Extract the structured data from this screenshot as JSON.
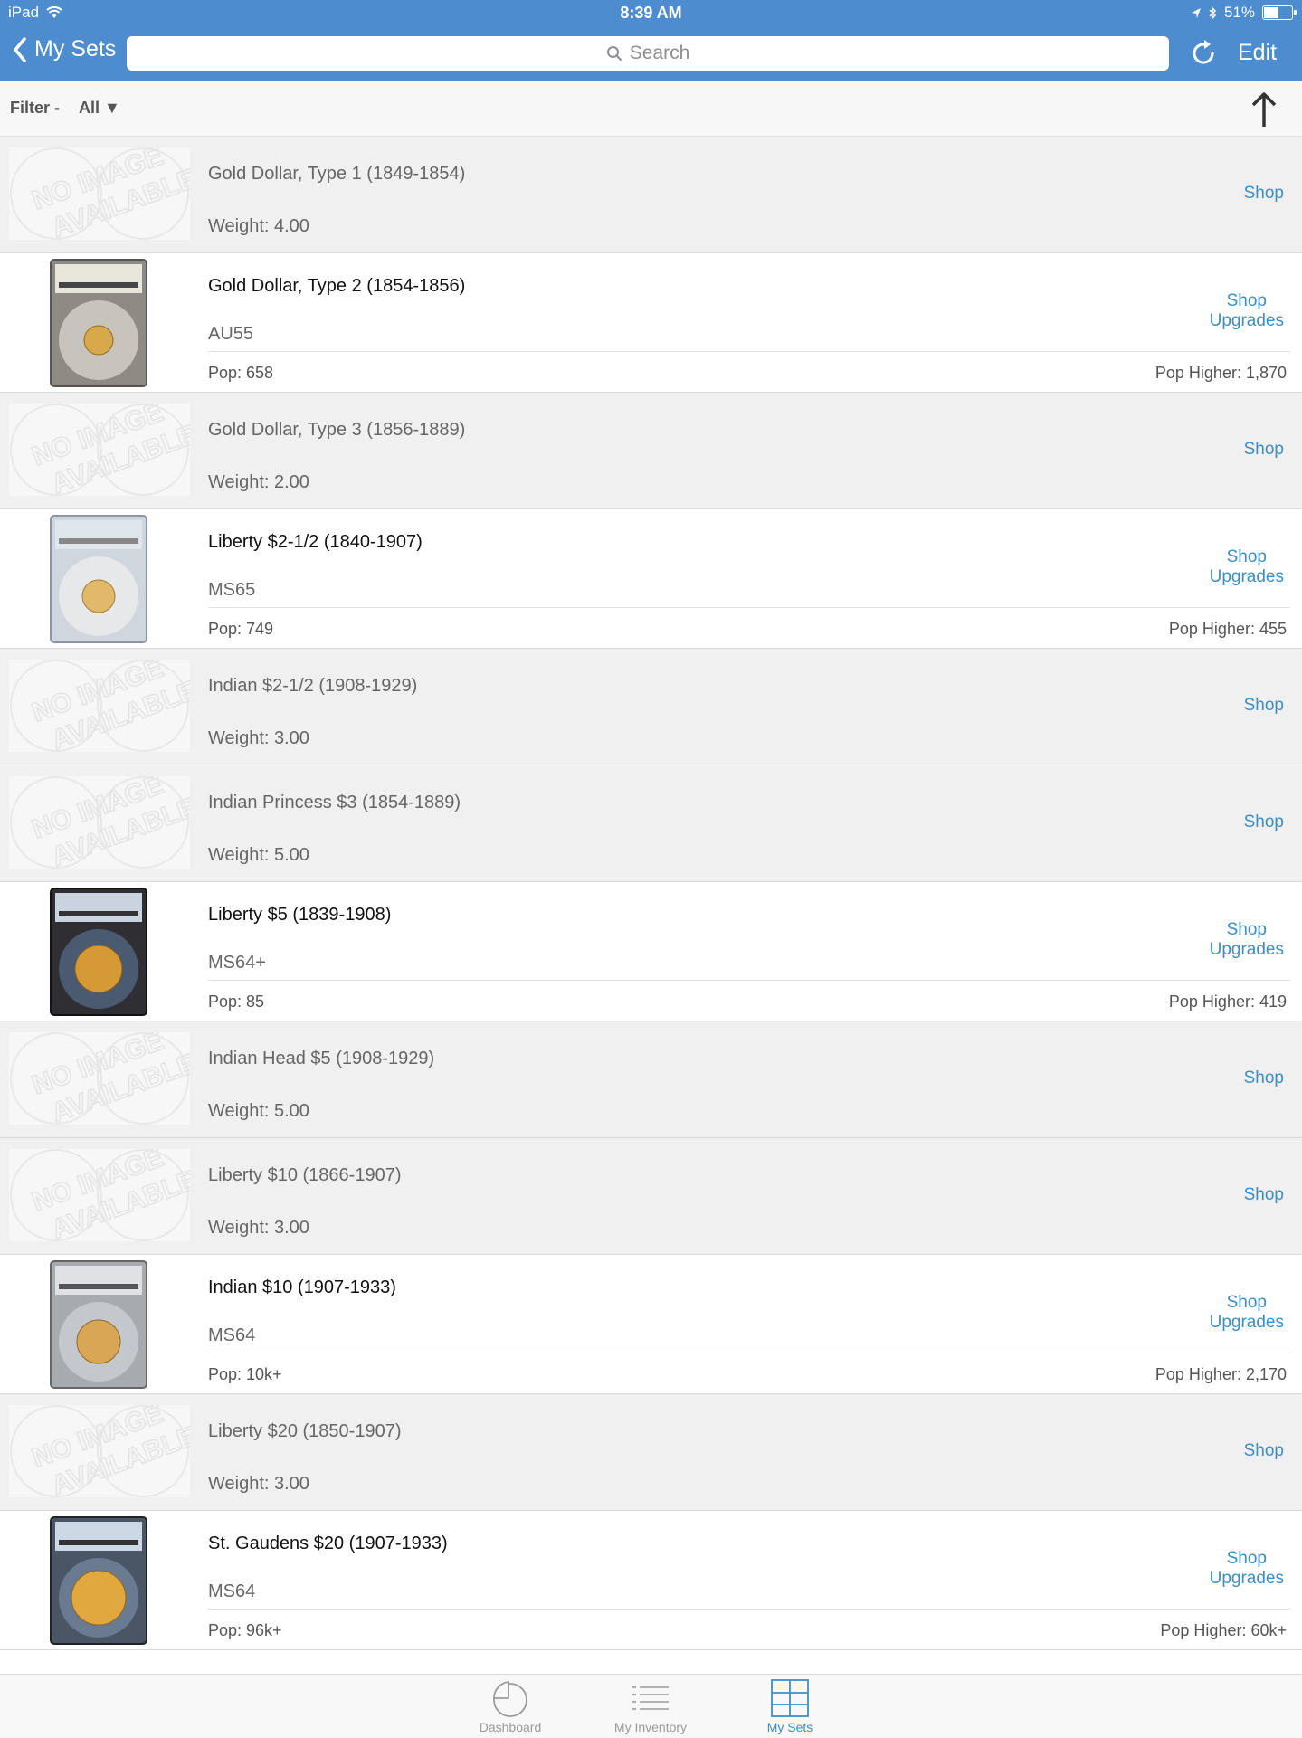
{
  "status_bar": {
    "device": "iPad",
    "time": "8:39 AM",
    "battery": "51%"
  },
  "nav": {
    "back_label": "My Sets",
    "search_placeholder": "Search",
    "edit_label": "Edit"
  },
  "filter": {
    "label": "Filter -",
    "value": "All ▼"
  },
  "rows": [
    {
      "title": "Gold Dollar, Type 1 (1849-1854)",
      "sub": "Weight: 4.00",
      "shop": "Shop"
    },
    {
      "title": "Gold Dollar, Type 2 (1854-1856)",
      "sub": "AU55",
      "shop_line1": "Shop",
      "shop_line2": "Upgrades",
      "pop": "Pop: 658",
      "pop_higher": "Pop Higher: 1,870"
    },
    {
      "title": "Gold Dollar, Type 3 (1856-1889)",
      "sub": "Weight: 2.00",
      "shop": "Shop"
    },
    {
      "title": "Liberty $2-1/2 (1840-1907)",
      "sub": "MS65",
      "shop_line1": "Shop",
      "shop_line2": "Upgrades",
      "pop": "Pop: 749",
      "pop_higher": "Pop Higher: 455"
    },
    {
      "title": "Indian $2-1/2 (1908-1929)",
      "sub": "Weight: 3.00",
      "shop": "Shop"
    },
    {
      "title": "Indian Princess $3 (1854-1889)",
      "sub": "Weight: 5.00",
      "shop": "Shop"
    },
    {
      "title": "Liberty $5 (1839-1908)",
      "sub": "MS64+",
      "shop_line1": "Shop",
      "shop_line2": "Upgrades",
      "pop": "Pop: 85",
      "pop_higher": "Pop Higher: 419"
    },
    {
      "title": "Indian Head $5 (1908-1929)",
      "sub": "Weight: 5.00",
      "shop": "Shop"
    },
    {
      "title": "Liberty $10 (1866-1907)",
      "sub": "Weight: 3.00",
      "shop": "Shop"
    },
    {
      "title": "Indian $10 (1907-1933)",
      "sub": "MS64",
      "shop_line1": "Shop",
      "shop_line2": "Upgrades",
      "pop": "Pop: 10k+",
      "pop_higher": "Pop Higher: 2,170"
    },
    {
      "title": "Liberty $20 (1850-1907)",
      "sub": "Weight: 3.00",
      "shop": "Shop"
    },
    {
      "title": "St. Gaudens $20 (1907-1933)",
      "sub": "MS64",
      "shop_line1": "Shop",
      "shop_line2": "Upgrades",
      "pop": "Pop: 96k+",
      "pop_higher": "Pop Higher: 60k+"
    }
  ],
  "tabs": [
    {
      "label": "Dashboard"
    },
    {
      "label": "My Inventory"
    },
    {
      "label": "My Sets"
    }
  ],
  "colors": {
    "nav_blue": "#4d8ccf",
    "link_blue": "#3c8fc4",
    "empty_row_bg": "#f0f0f0"
  },
  "icons": [
    "wifi-icon",
    "location-icon",
    "bluetooth-icon",
    "battery-icon",
    "chevron-left-icon",
    "search-icon",
    "refresh-icon",
    "arrow-up-icon",
    "pie-chart-icon",
    "list-icon",
    "grid-icon"
  ]
}
